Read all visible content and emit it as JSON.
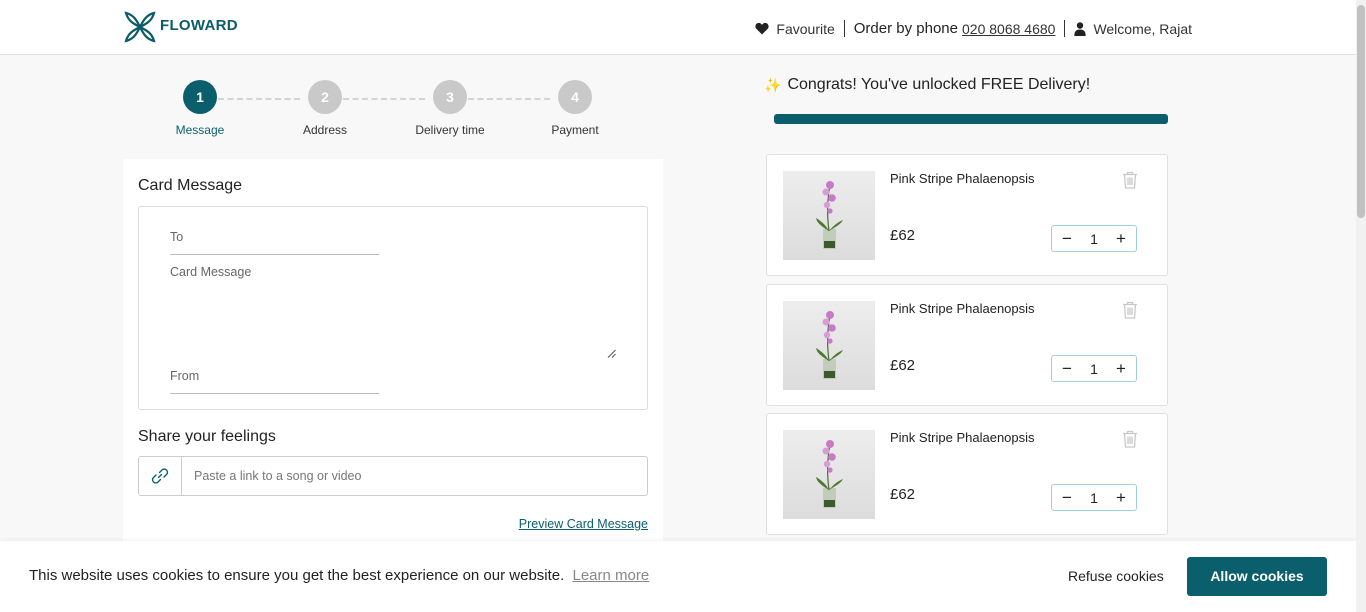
{
  "header": {
    "logo_text": "FLOWARD",
    "favourite_label": "Favourite",
    "order_by_phone_label": "Order by phone",
    "phone_number": "020 8068 4680",
    "welcome_text": "Welcome, Rajat"
  },
  "stepper": {
    "steps": [
      {
        "number": "1",
        "label": "Message",
        "active": true
      },
      {
        "number": "2",
        "label": "Address",
        "active": false
      },
      {
        "number": "3",
        "label": "Delivery time",
        "active": false
      },
      {
        "number": "4",
        "label": "Payment",
        "active": false
      }
    ]
  },
  "card_message": {
    "title": "Card Message",
    "to_label": "To",
    "message_label": "Card Message",
    "from_label": "From"
  },
  "feelings": {
    "title": "Share your feelings",
    "link_placeholder": "Paste a link to a song or video",
    "preview_label": "Preview Card Message"
  },
  "delivery": {
    "message": "Congrats! You've unlocked FREE Delivery!",
    "progress_percent": 100
  },
  "cart": {
    "items": [
      {
        "name": "Pink Stripe Phalaenopsis",
        "price": "£62",
        "quantity": "1"
      },
      {
        "name": "Pink Stripe Phalaenopsis",
        "price": "£62",
        "quantity": "1"
      },
      {
        "name": "Pink Stripe Phalaenopsis",
        "price": "£62",
        "quantity": "1"
      }
    ]
  },
  "cookies": {
    "text": "This website uses cookies to ensure you get the best experience on our website.",
    "learn_more": "Learn more",
    "refuse_label": "Refuse cookies",
    "allow_label": "Allow cookies"
  },
  "colors": {
    "brand": "#0b5f6d",
    "inactive_step": "#c9c9c9"
  }
}
